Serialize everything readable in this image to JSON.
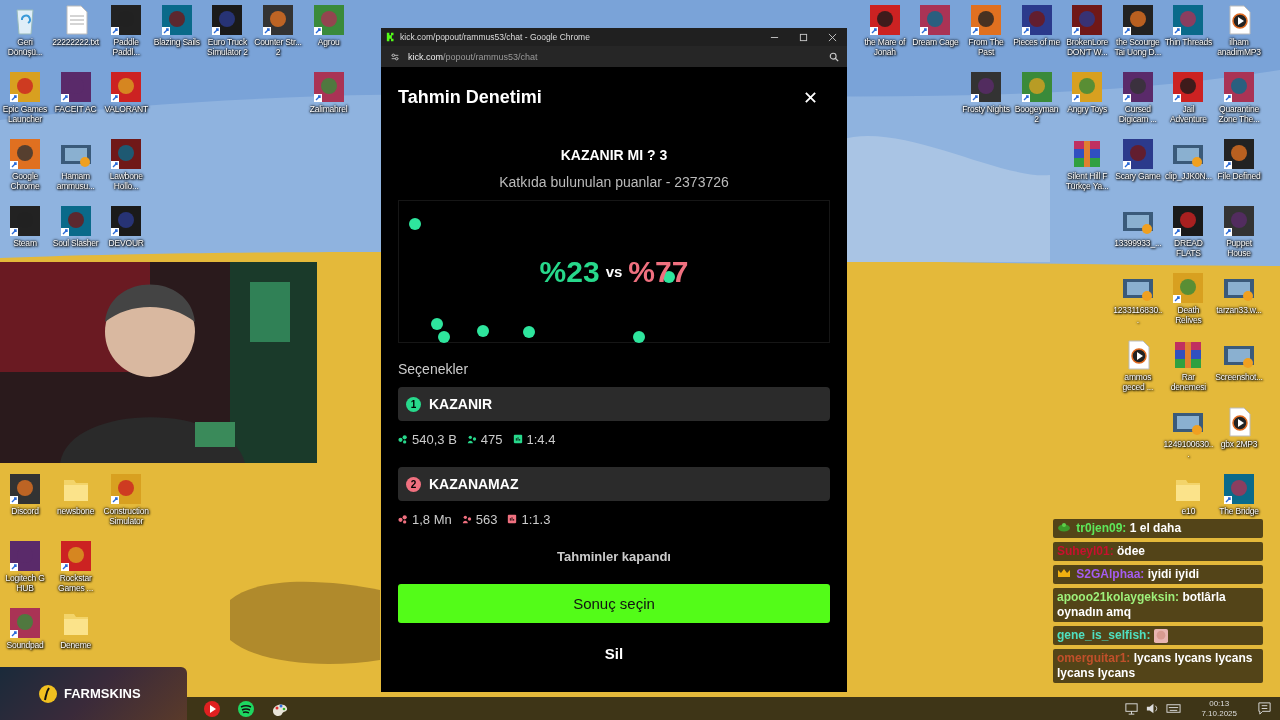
{
  "left_icons": [
    {
      "label": "Geri Dönüşü...",
      "kind": "bin"
    },
    {
      "label": "22222222.txt",
      "kind": "file"
    },
    {
      "label": "Paddle Paddl...",
      "kind": "app"
    },
    {
      "label": "Blazing Sails",
      "kind": "app"
    },
    {
      "label": "Euro Truck Simulator 2",
      "kind": "app"
    },
    {
      "label": "Counter Str... 2",
      "kind": "app"
    },
    {
      "label": "Agrou",
      "kind": "app"
    },
    {
      "label": "Epic Games Launcher",
      "kind": "app"
    },
    {
      "label": "FACEIT AC",
      "kind": "app"
    },
    {
      "label": "VALORANT",
      "kind": "app"
    },
    {
      "label": "Zalimahrel",
      "kind": "app"
    },
    {
      "label": "Google Chrome",
      "kind": "app"
    },
    {
      "label": "Hamam ammusu...",
      "kind": "video"
    },
    {
      "label": "Lawbone Hollo...",
      "kind": "app"
    },
    {
      "label": "Steam",
      "kind": "app"
    },
    {
      "label": "Soul Slasher",
      "kind": "app"
    },
    {
      "label": "DEVOUR",
      "kind": "app"
    },
    {
      "label": "Discord",
      "kind": "app"
    },
    {
      "label": "newsbone",
      "kind": "folder"
    },
    {
      "label": "Construction Simulator",
      "kind": "app"
    },
    {
      "label": "Logitech G HUB",
      "kind": "app"
    },
    {
      "label": "Rockstar Games ...",
      "kind": "app"
    },
    {
      "label": "Soundpad",
      "kind": "app"
    },
    {
      "label": "Deneme",
      "kind": "folder"
    }
  ],
  "right_icons": [
    {
      "label": "the Mare of Jonah",
      "kind": "app"
    },
    {
      "label": "Dream Cage",
      "kind": "app"
    },
    {
      "label": "From The Past",
      "kind": "app"
    },
    {
      "label": "Pieces of me",
      "kind": "app"
    },
    {
      "label": "BrokenLore DON'T W...",
      "kind": "app"
    },
    {
      "label": "the Scourge Tai Uong D...",
      "kind": "app"
    },
    {
      "label": "Thin Threads",
      "kind": "app"
    },
    {
      "label": "ilham anadimMP3",
      "kind": "media"
    },
    {
      "label": "Frosty Nights",
      "kind": "app"
    },
    {
      "label": "Boogeyman 2",
      "kind": "app"
    },
    {
      "label": "Angry Toys",
      "kind": "app"
    },
    {
      "label": "Cursed Digicam ...",
      "kind": "app"
    },
    {
      "label": "Jail Adventure",
      "kind": "app"
    },
    {
      "label": "Quarantine Zone The...",
      "kind": "app"
    },
    {
      "label": "Silent Hill F Türkçe Ya...",
      "kind": "archive"
    },
    {
      "label": "Scary Game",
      "kind": "app"
    },
    {
      "label": "clip_JJK0N...",
      "kind": "video"
    },
    {
      "label": "File Defined",
      "kind": "app"
    },
    {
      "label": "13399933_...",
      "kind": "video"
    },
    {
      "label": "DREAD FLATS",
      "kind": "app"
    },
    {
      "label": "Puppet House",
      "kind": "app"
    },
    {
      "label": "1233116830...",
      "kind": "video"
    },
    {
      "label": "Death Relives",
      "kind": "app"
    },
    {
      "label": "tarzan33.w...",
      "kind": "video"
    },
    {
      "label": "ammos geced ...",
      "kind": "media"
    },
    {
      "label": "Rar denemesi",
      "kind": "archive"
    },
    {
      "label": "Screenshot...",
      "kind": "video"
    },
    {
      "label": "1249100630...",
      "kind": "video"
    },
    {
      "label": "gbx 2MP3",
      "kind": "media"
    },
    {
      "label": "e10",
      "kind": "folder"
    },
    {
      "label": "The Bridge",
      "kind": "app"
    }
  ],
  "overlay_banner": {
    "title": "FARMSKINS"
  },
  "browser": {
    "title": "kick.com/popout/rammus53/chat - Google Chrome",
    "url_host": "kick.com",
    "url_path": "/popout/rammus53/chat",
    "dialog": {
      "title": "Tahmin Denetimi",
      "question": "KAZANIR MI ? 3",
      "contributed": "Katkıda bulunulan puanlar - 2373726",
      "result": {
        "left": "%23",
        "vs": "vs",
        "right": "%77"
      },
      "options_heading": "Seçenekler",
      "options": [
        {
          "number": "1",
          "label": "KAZANIR",
          "color": "#27d88b",
          "points": "540,3 B",
          "users": "475",
          "ratio": "1:4.4"
        },
        {
          "number": "2",
          "label": "KAZANAMAZ",
          "color": "#f0707f",
          "points": "1,8 Mn",
          "users": "563",
          "ratio": "1:1.3"
        }
      ],
      "status": "Tahminler kapandı",
      "primary_button": "Sonuç seçin",
      "delete_button": "Sil"
    }
  },
  "chat": [
    {
      "user": "tr0jen09:",
      "color": "#5ee85a",
      "text": "1 el daha",
      "kind": "subscriber"
    },
    {
      "user": "Suheyl01:",
      "color": "#c8102e",
      "text": "ödee"
    },
    {
      "user": "S2GAlphaa:",
      "color": "#a45cf0",
      "text": "iyidi iyidi",
      "kind": "vip"
    },
    {
      "user": "apooo21kolaygeksin:",
      "color": "#9ef07a",
      "text": "botlârla oynadın amq"
    },
    {
      "user": "gene_is_selfish:",
      "color": "#4fe0c0",
      "emote": true
    },
    {
      "user": "omerguitar1:",
      "color": "#c0502a",
      "text": "lycans lycans lycans lycans lycans"
    }
  ],
  "clock": {
    "time": "00:13",
    "date": "7.10.2025"
  }
}
